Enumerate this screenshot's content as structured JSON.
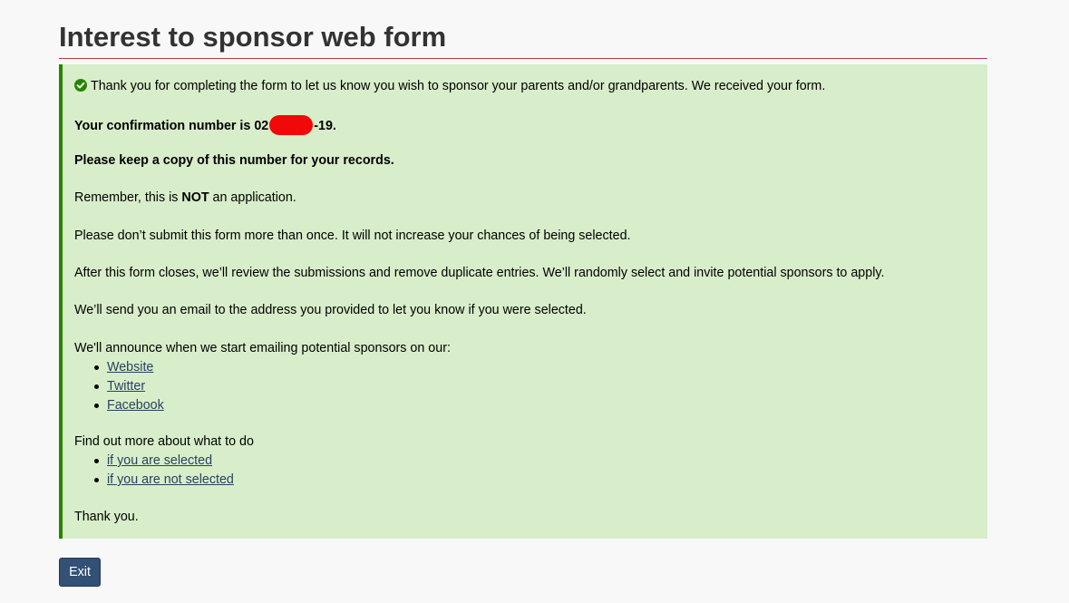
{
  "page": {
    "title": "Interest to sponsor web form"
  },
  "alert": {
    "success_message": "Thank you for completing the form to let us know you wish to sponsor your parents and/or grandparents. We received your form.",
    "confirmation_prefix": "Your confirmation number is 02",
    "confirmation_suffix": "-19.",
    "keep_copy": "Please keep a copy of this number for your records.",
    "remember_prefix": "Remember, this is ",
    "remember_emphasis": "NOT",
    "remember_suffix": " an application.",
    "dont_submit": "Please don’t submit this form more than once. It will not increase your chances of being selected.",
    "after_close": "After this form closes, we’ll review the submissions and remove duplicate entries. We’ll randomly select and invite potential sponsors to apply.",
    "email_notice": "We’ll send you an email to the address you provided to let you know if you were selected.",
    "announce_intro": "We'll announce when we start emailing potential sponsors on our:",
    "announce_links": [
      "Website",
      "Twitter",
      "Facebook"
    ],
    "find_out_intro": "Find out more about what to do",
    "find_out_links": [
      "if you are selected",
      "if you are not selected"
    ],
    "thank_you": "Thank you."
  },
  "buttons": {
    "exit_label": "Exit"
  },
  "colors": {
    "alert_background": "#d8eeca",
    "alert_border": "#278400",
    "title_rule": "#af3c43",
    "link": "#284162",
    "exit_button": "#335075",
    "redaction": "#f10808"
  },
  "icons": {
    "success": "check-circle-icon"
  }
}
